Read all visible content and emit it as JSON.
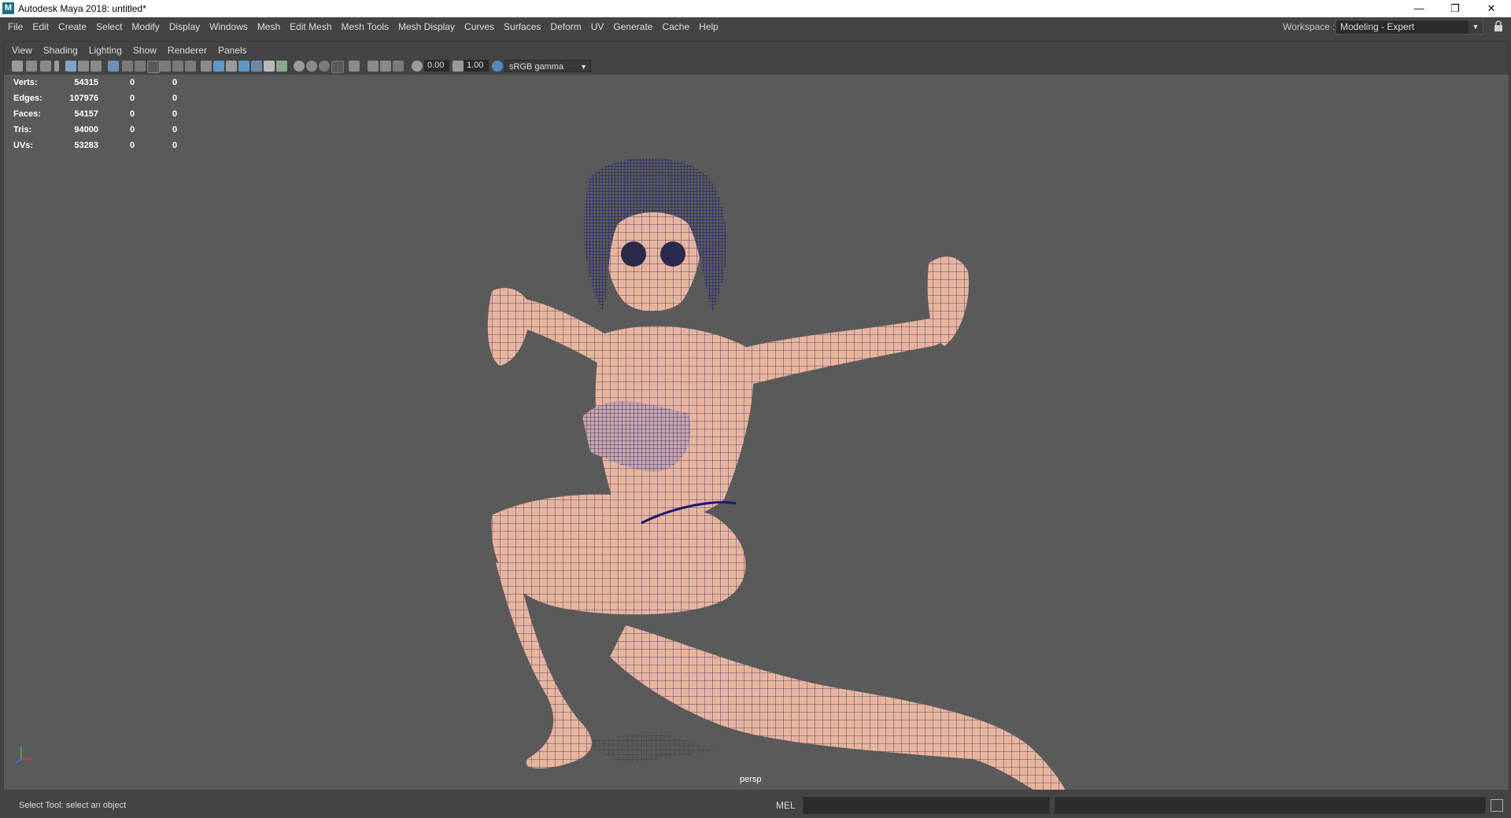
{
  "window": {
    "title": "Autodesk Maya 2018: untitled*",
    "app_icon": "M",
    "minimize": "—",
    "restore": "❐",
    "close": "✕"
  },
  "menu": {
    "items": [
      "File",
      "Edit",
      "Create",
      "Select",
      "Modify",
      "Display",
      "Windows",
      "Mesh",
      "Edit Mesh",
      "Mesh Tools",
      "Mesh Display",
      "Curves",
      "Surfaces",
      "Deform",
      "UV",
      "Generate",
      "Cache",
      "Help"
    ]
  },
  "workspace": {
    "label": "Workspace :",
    "value": "Modeling - Expert"
  },
  "panel_menu": {
    "items": [
      "View",
      "Shading",
      "Lighting",
      "Show",
      "Renderer",
      "Panels"
    ]
  },
  "toolbar": {
    "field_a": "0.00",
    "field_b": "1.00",
    "color_space": "sRGB gamma"
  },
  "hud": {
    "rows": [
      {
        "label": "Verts:",
        "v1": "54315",
        "v2": "0",
        "v3": "0"
      },
      {
        "label": "Edges:",
        "v1": "107976",
        "v2": "0",
        "v3": "0"
      },
      {
        "label": "Faces:",
        "v1": "54157",
        "v2": "0",
        "v3": "0"
      },
      {
        "label": "Tris:",
        "v1": "94000",
        "v2": "0",
        "v3": "0"
      },
      {
        "label": "UVs:",
        "v1": "53283",
        "v2": "0",
        "v3": "0"
      }
    ]
  },
  "viewport": {
    "camera": "persp",
    "mesh_color": "#e8b49c",
    "wire_color": "#1a1a6e"
  },
  "status": {
    "help_line": "Select Tool: select an object",
    "mel_label": "MEL"
  }
}
